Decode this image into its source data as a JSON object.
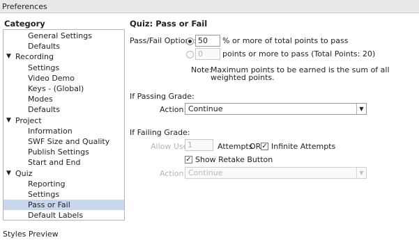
{
  "window": {
    "title": "Preferences"
  },
  "category": {
    "header": "Category",
    "items": [
      {
        "label": "General Settings",
        "level": 1,
        "expander": ""
      },
      {
        "label": "Defaults",
        "level": 1,
        "expander": ""
      },
      {
        "label": "Recording",
        "level": 0,
        "expander": "▼"
      },
      {
        "label": "Settings",
        "level": 1,
        "expander": ""
      },
      {
        "label": "Video Demo",
        "level": 1,
        "expander": ""
      },
      {
        "label": "Keys - (Global)",
        "level": 1,
        "expander": ""
      },
      {
        "label": "Modes",
        "level": 1,
        "expander": ""
      },
      {
        "label": "Defaults",
        "level": 1,
        "expander": ""
      },
      {
        "label": "Project",
        "level": 0,
        "expander": "▼"
      },
      {
        "label": "Information",
        "level": 1,
        "expander": ""
      },
      {
        "label": "SWF Size and Quality",
        "level": 1,
        "expander": ""
      },
      {
        "label": "Publish Settings",
        "level": 1,
        "expander": ""
      },
      {
        "label": "Start and End",
        "level": 1,
        "expander": ""
      },
      {
        "label": "Quiz",
        "level": 0,
        "expander": "▼"
      },
      {
        "label": "Reporting",
        "level": 1,
        "expander": ""
      },
      {
        "label": "Settings",
        "level": 1,
        "expander": ""
      },
      {
        "label": "Pass or Fail",
        "level": 1,
        "expander": "",
        "selected": true
      },
      {
        "label": "Default Labels",
        "level": 1,
        "expander": ""
      }
    ],
    "styles_preview": "Styles Preview"
  },
  "panel": {
    "title": "Quiz: Pass or Fail",
    "pass_fail_options_label": "Pass/Fail Options:",
    "percent_value": "50",
    "percent_text": "% or more of total points to pass",
    "points_value": "0",
    "points_text": "points or more to pass (Total Points: 20)",
    "note_label": "Note:",
    "note_line1": "Maximum points to be earned is the sum of all",
    "note_line2": "weighted points.",
    "if_passing_label": "If Passing Grade:",
    "pass_action_label": "Action:",
    "pass_action_value": "Continue",
    "if_failing_label": "If Failing Grade:",
    "allow_user_label": "Allow User:",
    "attempts_value": "1",
    "attempts_text": "Attempts",
    "or_text": "OR",
    "infinite_attempts_label": "Infinite Attempts",
    "show_retake_label": "Show Retake Button",
    "fail_action_label": "Action:",
    "fail_action_value": "Continue"
  }
}
